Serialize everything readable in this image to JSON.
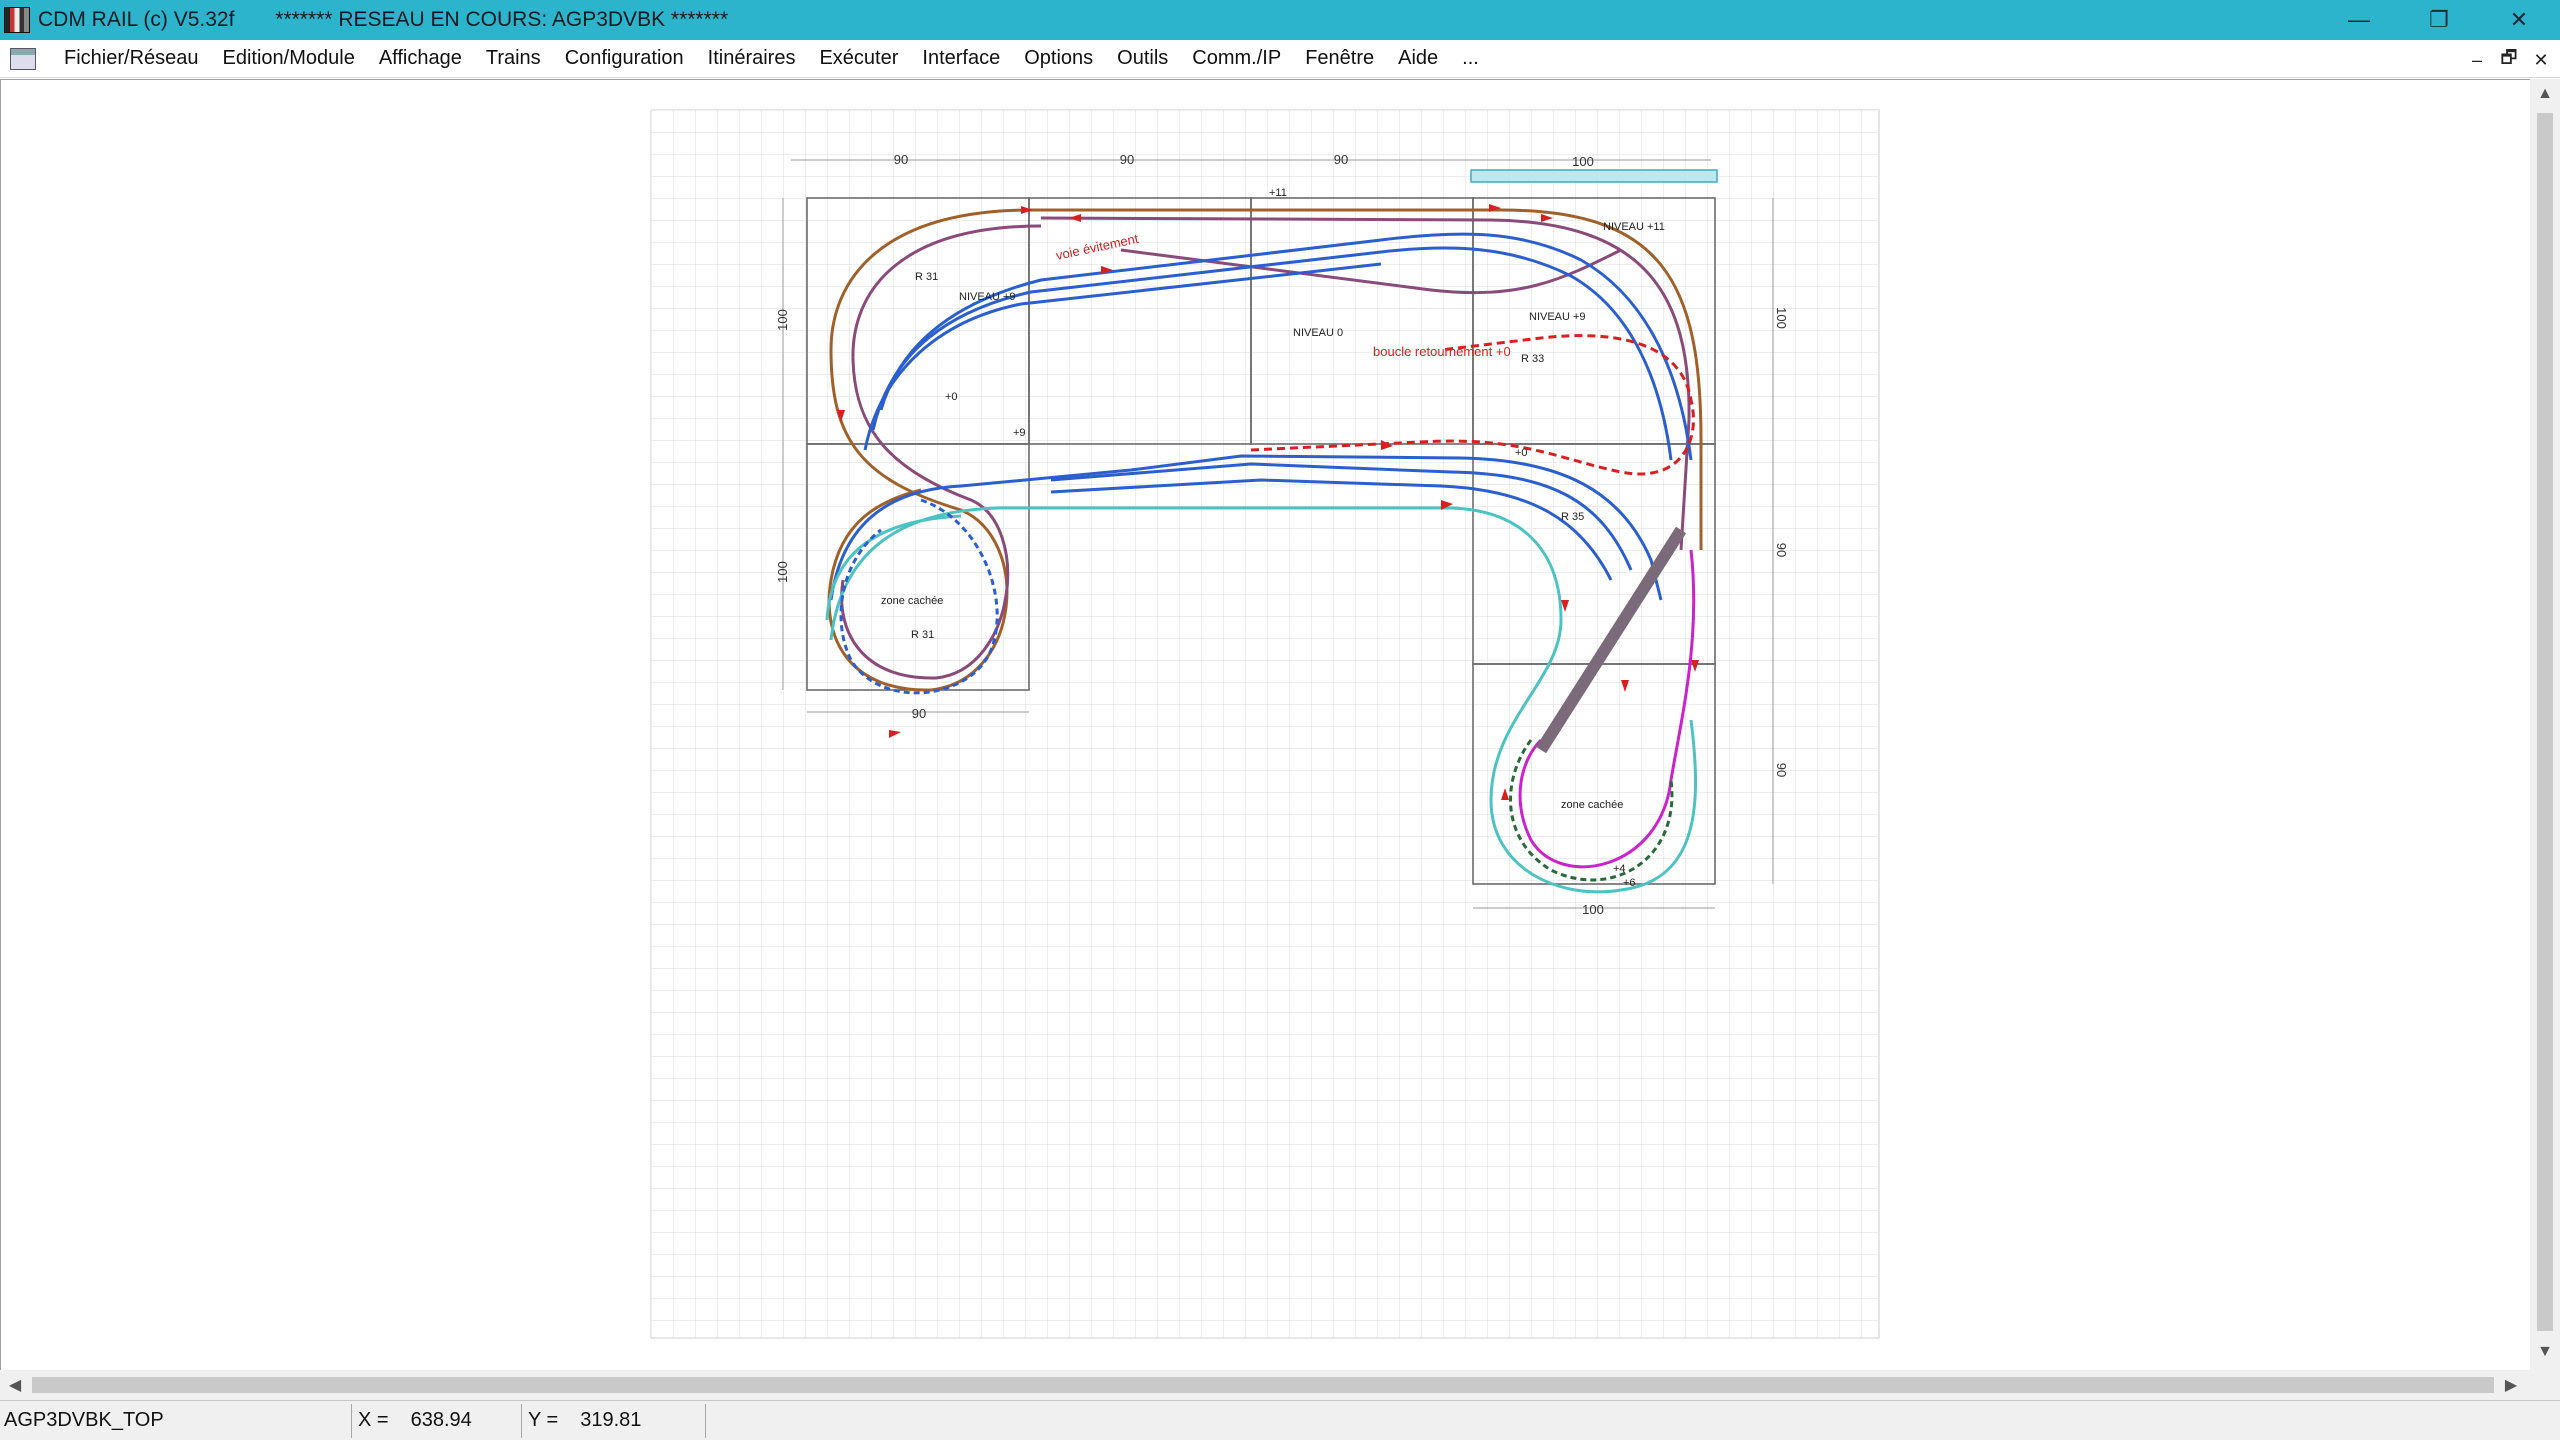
{
  "window": {
    "title": "CDM RAIL (c) V5.32f       ******* RESEAU EN COURS: AGP3DVBK *******",
    "minimize": "—",
    "restore": "❐",
    "close": "✕"
  },
  "menu": {
    "items": [
      "Fichier/Réseau",
      "Edition/Module",
      "Affichage",
      "Trains",
      "Configuration",
      "Itinéraires",
      "Exécuter",
      "Interface",
      "Options",
      "Outils",
      "Comm./IP",
      "Fenêtre",
      "Aide",
      "..."
    ],
    "mdi_minimize": "–",
    "mdi_restore": "🗗",
    "mdi_close": "✕"
  },
  "layout_plan": {
    "dimensions_top": [
      "90",
      "90",
      "90",
      "100"
    ],
    "dimensions_left": [
      "100",
      "100"
    ],
    "dimension_bottom_left": "90",
    "dimensions_right": [
      "100",
      "90",
      "90"
    ],
    "dimension_bottom_right": "100",
    "labels": {
      "niveau_plus11": "NIVEAU +11",
      "niveau_plus9_left": "NIVEAU +9",
      "niveau_0": "NIVEAU 0",
      "niveau_plus9_right": "NIVEAU +9",
      "voie_evitement": "voie évitement",
      "boucle_retournement": "boucle retournement +0",
      "zone_cachee_left": "zone cachée",
      "zone_cachee_right": "zone cachée",
      "r31_left": "R 31",
      "r31_top": "R 31",
      "r33": "R 33",
      "r35": "R 35",
      "plus0_a": "+0",
      "plus0_b": "+0",
      "plus9": "+9",
      "plus11": "+11",
      "plus4": "+4",
      "plus6": "+6"
    }
  },
  "colors": {
    "grid": "#d9d9d9",
    "module_border": "#6a6a6a",
    "track_blue": "#2b5fd0",
    "track_teal": "#4cc3c3",
    "track_purple": "#8a4a7a",
    "track_brown": "#a0602a",
    "track_red": "#d82020",
    "track_magenta": "#cc22cc",
    "highlight_bar": "#bfe8ee"
  },
  "status": {
    "network": "AGP3DVBK_TOP",
    "x_label": "X =",
    "x_value": "638.94",
    "y_label": "Y =",
    "y_value": "319.81"
  }
}
